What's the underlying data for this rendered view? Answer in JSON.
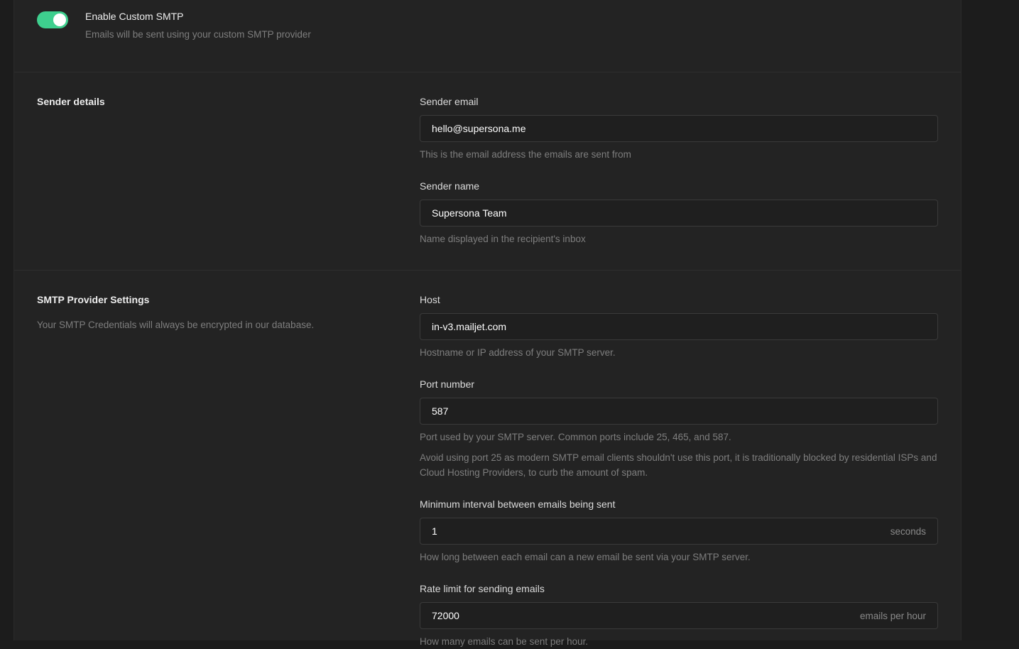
{
  "smtp_toggle": {
    "enabled": true,
    "title": "Enable Custom SMTP",
    "description": "Emails will be sent using your custom SMTP provider",
    "color": "#3ecf8e"
  },
  "sender_details": {
    "title": "Sender details",
    "sender_email": {
      "label": "Sender email",
      "value": "hello@supersona.me",
      "help": "This is the email address the emails are sent from"
    },
    "sender_name": {
      "label": "Sender name",
      "value": "Supersona Team",
      "help": "Name displayed in the recipient's inbox"
    }
  },
  "smtp_provider": {
    "title": "SMTP Provider Settings",
    "description": "Your SMTP Credentials will always be encrypted in our database.",
    "host": {
      "label": "Host",
      "value": "in-v3.mailjet.com",
      "help": "Hostname or IP address of your SMTP server."
    },
    "port": {
      "label": "Port number",
      "value": "587",
      "help": "Port used by your SMTP server. Common ports include 25, 465, and 587.",
      "help2": "Avoid using port 25 as modern SMTP email clients shouldn't use this port, it is traditionally blocked by residential ISPs and Cloud Hosting Providers, to curb the amount of spam."
    },
    "min_interval": {
      "label": "Minimum interval between emails being sent",
      "value": "1",
      "suffix": "seconds",
      "help": "How long between each email can a new email be sent via your SMTP server."
    },
    "rate_limit": {
      "label": "Rate limit for sending emails",
      "value": "72000",
      "suffix": "emails per hour",
      "help": "How many emails can be sent per hour."
    }
  }
}
